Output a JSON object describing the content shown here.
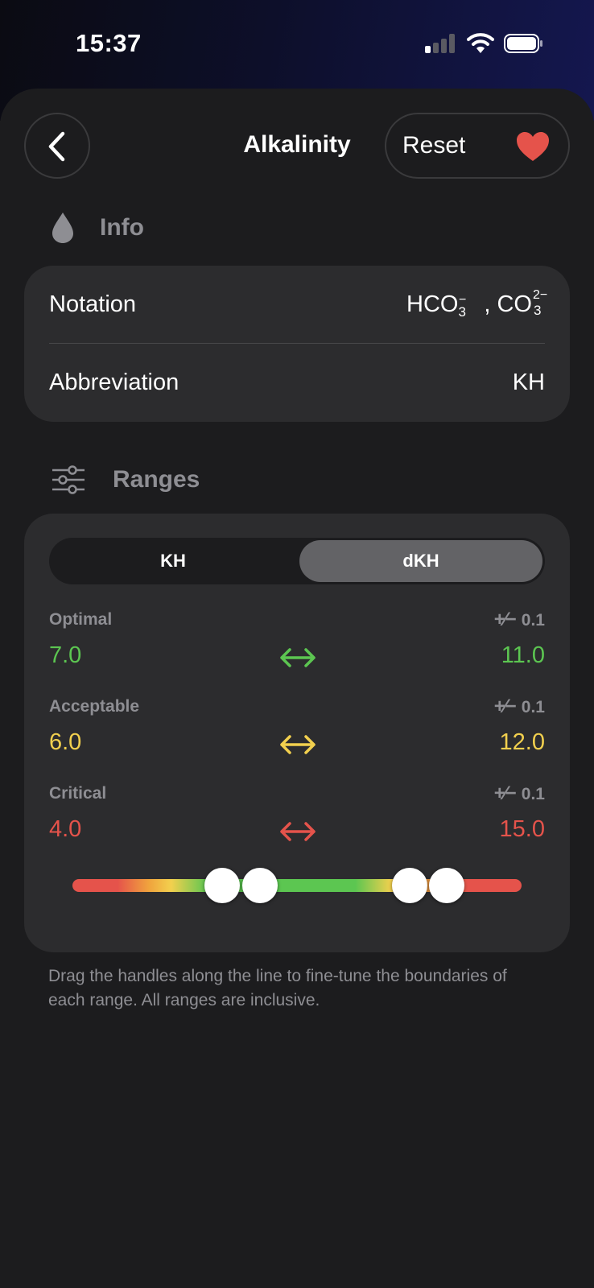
{
  "status_bar": {
    "time": "15:37"
  },
  "nav": {
    "title": "Alkalinity",
    "reset_label": "Reset"
  },
  "info": {
    "section_title": "Info",
    "rows": [
      {
        "label": "Notation",
        "value_parts": [
          "HCO",
          "3",
          "−",
          ", CO",
          "3",
          "2−"
        ]
      },
      {
        "label": "Abbreviation",
        "value": "KH"
      }
    ]
  },
  "ranges": {
    "section_title": "Ranges",
    "units": [
      "KH",
      "dKH"
    ],
    "selected_unit": "dKH",
    "items": [
      {
        "name": "Optimal",
        "tolerance": "0.1",
        "min": "7.0",
        "max": "11.0",
        "color": "#5cc651"
      },
      {
        "name": "Acceptable",
        "tolerance": "0.1",
        "min": "6.0",
        "max": "12.0",
        "color": "#f2d04e"
      },
      {
        "name": "Critical",
        "tolerance": "0.1",
        "min": "4.0",
        "max": "15.0",
        "color": "#e5534b"
      }
    ],
    "slider_handles": [
      6.0,
      7.0,
      11.0,
      12.0
    ],
    "slider_scale": [
      2.0,
      14.0
    ],
    "tolerance_symbol": "+⁄−"
  },
  "footnote": "Drag the handles along the line to fine-tune the boundaries of each range. All ranges are inclusive.",
  "colors": {
    "accent_heart": "#e5534b",
    "background": "#1c1c1e",
    "card": "#2c2c2e"
  }
}
